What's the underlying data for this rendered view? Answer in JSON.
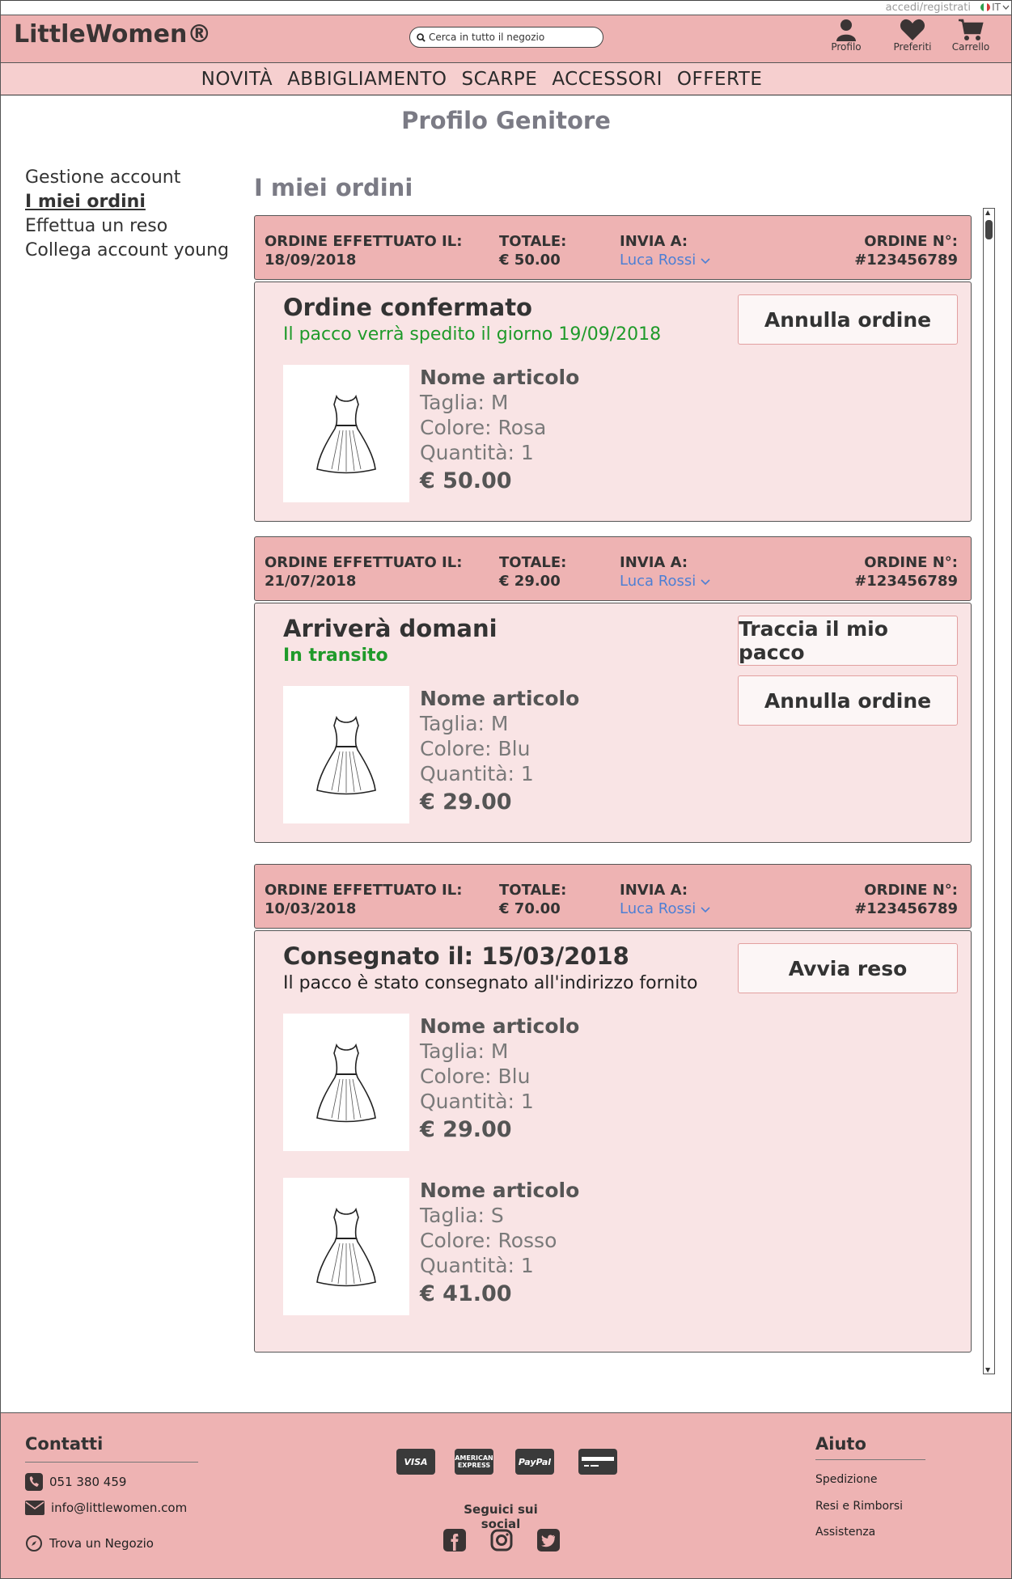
{
  "topbar": {
    "login_link": "accedi/registrati",
    "language": "IT"
  },
  "header": {
    "logo": "LittleWomen®",
    "search_placeholder": "Cerca in tutto il negozio",
    "icons": {
      "profile": "Profilo",
      "favorites": "Preferiti",
      "cart": "Carrello"
    }
  },
  "nav": [
    "NOVITÀ",
    "ABBIGLIAMENTO",
    "SCARPE",
    "ACCESSORI",
    "OFFERTE"
  ],
  "page_title": "Profilo Genitore",
  "sidebar": [
    "Gestione account",
    "I miei ordini",
    "Effettua un reso",
    "Collega account young"
  ],
  "orders_title": "I miei ordini",
  "order_labels": {
    "date": "ORDINE EFFETTUATO IL:",
    "total": "TOTALE:",
    "ship_to": "INVIA A:",
    "number": "ORDINE N°:"
  },
  "orders": [
    {
      "date": "18/09/2018",
      "total": "€ 50.00",
      "recipient": "Luca Rossi",
      "number": "#123456789",
      "status_title": "Ordine confermato",
      "status_sub": "Il pacco verrà spedito il giorno 19/09/2018",
      "buttons": [
        "Annulla ordine"
      ],
      "items": [
        {
          "name": "Nome articolo",
          "size": "Taglia: M",
          "color": "Colore: Rosa",
          "qty": "Quantità: 1",
          "price": "€ 50.00"
        }
      ]
    },
    {
      "date": "21/07/2018",
      "total": "€ 29.00",
      "recipient": "Luca Rossi",
      "number": "#123456789",
      "status_title": "Arriverà domani",
      "status_sub": "In transito",
      "buttons": [
        "Traccia il mio pacco",
        "Annulla ordine"
      ],
      "items": [
        {
          "name": "Nome articolo",
          "size": "Taglia: M",
          "color": "Colore: Blu",
          "qty": "Quantità: 1",
          "price": "€ 29.00"
        }
      ]
    },
    {
      "date": "10/03/2018",
      "total": "€ 70.00",
      "recipient": "Luca Rossi",
      "number": "#123456789",
      "status_title": "Consegnato il: 15/03/2018",
      "status_sub": "Il pacco è stato consegnato all'indirizzo fornito",
      "buttons": [
        "Avvia reso"
      ],
      "items": [
        {
          "name": "Nome articolo",
          "size": "Taglia: M",
          "color": "Colore: Blu",
          "qty": "Quantità: 1",
          "price": "€ 29.00"
        },
        {
          "name": "Nome articolo",
          "size": "Taglia: S",
          "color": "Colore: Rosso",
          "qty": "Quantità: 1",
          "price": "€ 41.00"
        }
      ]
    }
  ],
  "footer": {
    "contacts_title": "Contatti",
    "phone": "051 380 459",
    "email": "info@littlewomen.com",
    "store": "Trova un Negozio",
    "payments": [
      "VISA",
      "AMERICAN EXPRESS",
      "PayPal",
      "card"
    ],
    "social_title": "Seguici sui social",
    "social": [
      "facebook",
      "instagram",
      "twitter"
    ],
    "help_title": "Aiuto",
    "help_links": [
      "Spedizione",
      "Resi e Rimborsi",
      "Assistenza"
    ]
  },
  "colors": {
    "header_bg": "#eeb3b3",
    "nav_bg": "#f6cfcf",
    "order_body_bg": "#f9e4e5",
    "green": "#1f9a2a",
    "link_blue": "#4d7fd4"
  }
}
